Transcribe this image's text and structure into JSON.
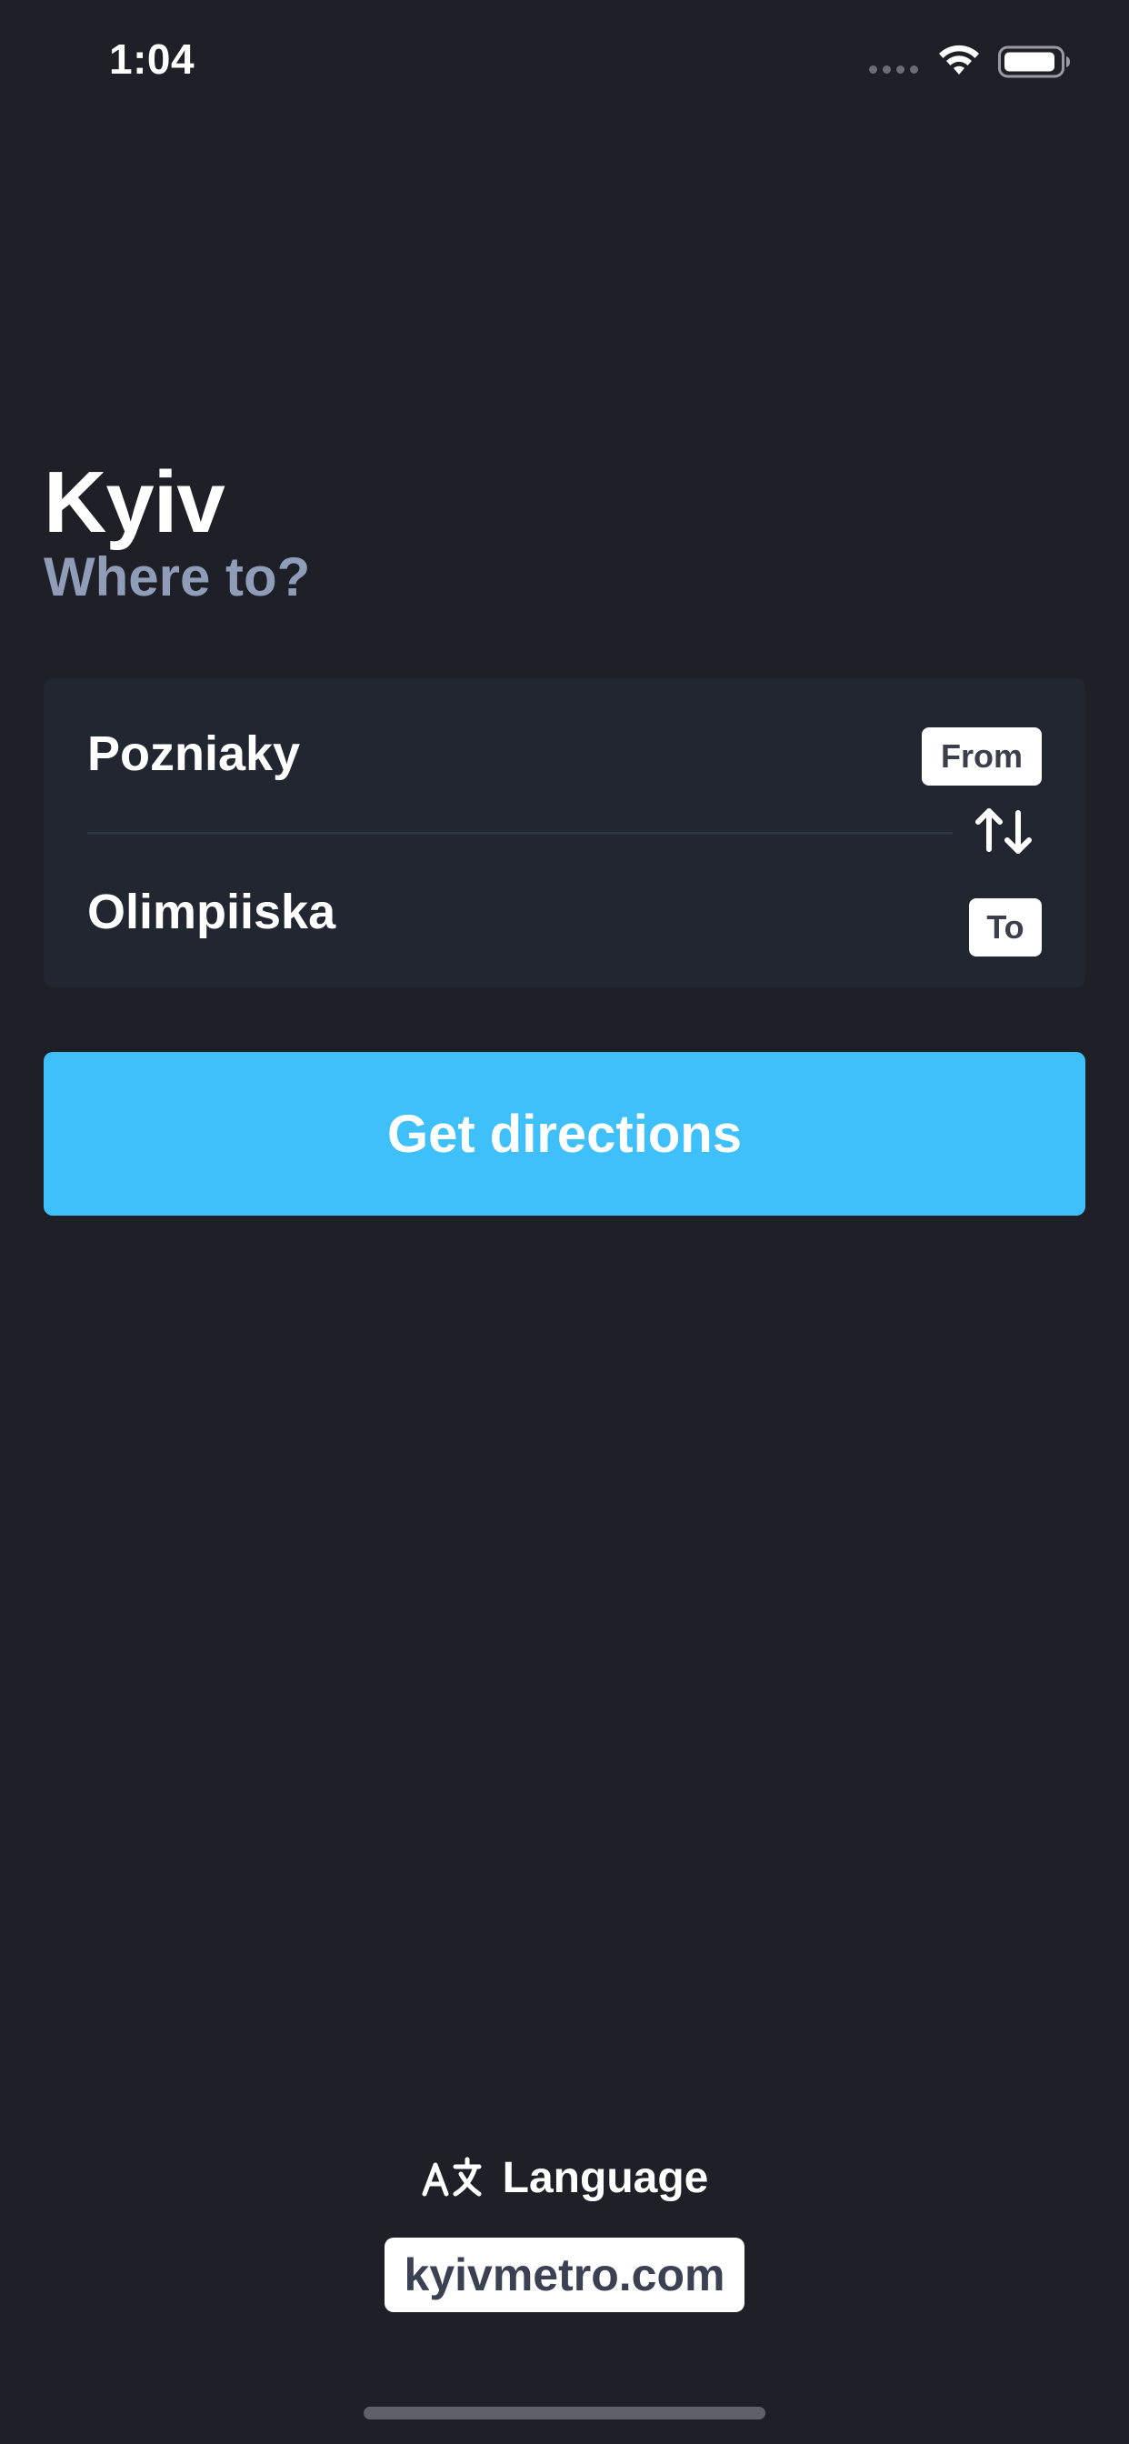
{
  "status_bar": {
    "time": "1:04",
    "icons": [
      "signal-dots-icon",
      "wifi-icon",
      "battery-icon"
    ]
  },
  "header": {
    "title": "Kyiv",
    "subtitle": "Where to?"
  },
  "route": {
    "from_station": "Pozniaky",
    "from_tag": "From",
    "to_station": "Olimpiiska",
    "to_tag": "To",
    "swap_icon": "swap-arrows-icon"
  },
  "actions": {
    "get_directions_label": "Get directions"
  },
  "footer": {
    "language_label": "Language",
    "language_icon": "translate-icon",
    "website_label": "kyivmetro.com"
  },
  "colors": {
    "background": "#1e1f27",
    "card": "#212631",
    "accent": "#40c0fa",
    "subtitle": "#8f9db8",
    "tag_text": "#3a3f4b"
  }
}
